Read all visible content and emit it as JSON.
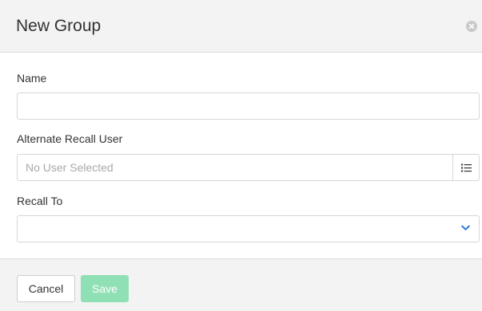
{
  "dialog": {
    "title": "New Group",
    "close_icon": "close-circle-icon"
  },
  "form": {
    "name": {
      "label": "Name",
      "value": ""
    },
    "alternate_recall_user": {
      "label": "Alternate Recall User",
      "value": "",
      "placeholder": "No User Selected",
      "picker_icon": "list-icon"
    },
    "recall_to": {
      "label": "Recall To",
      "selected": "",
      "icon": "chevron-down-icon"
    }
  },
  "footer": {
    "cancel_label": "Cancel",
    "save_label": "Save"
  },
  "colors": {
    "header_bg": "#f3f3f3",
    "save_button_bg": "#8fe0b4",
    "chevron": "#2f7bd8"
  }
}
